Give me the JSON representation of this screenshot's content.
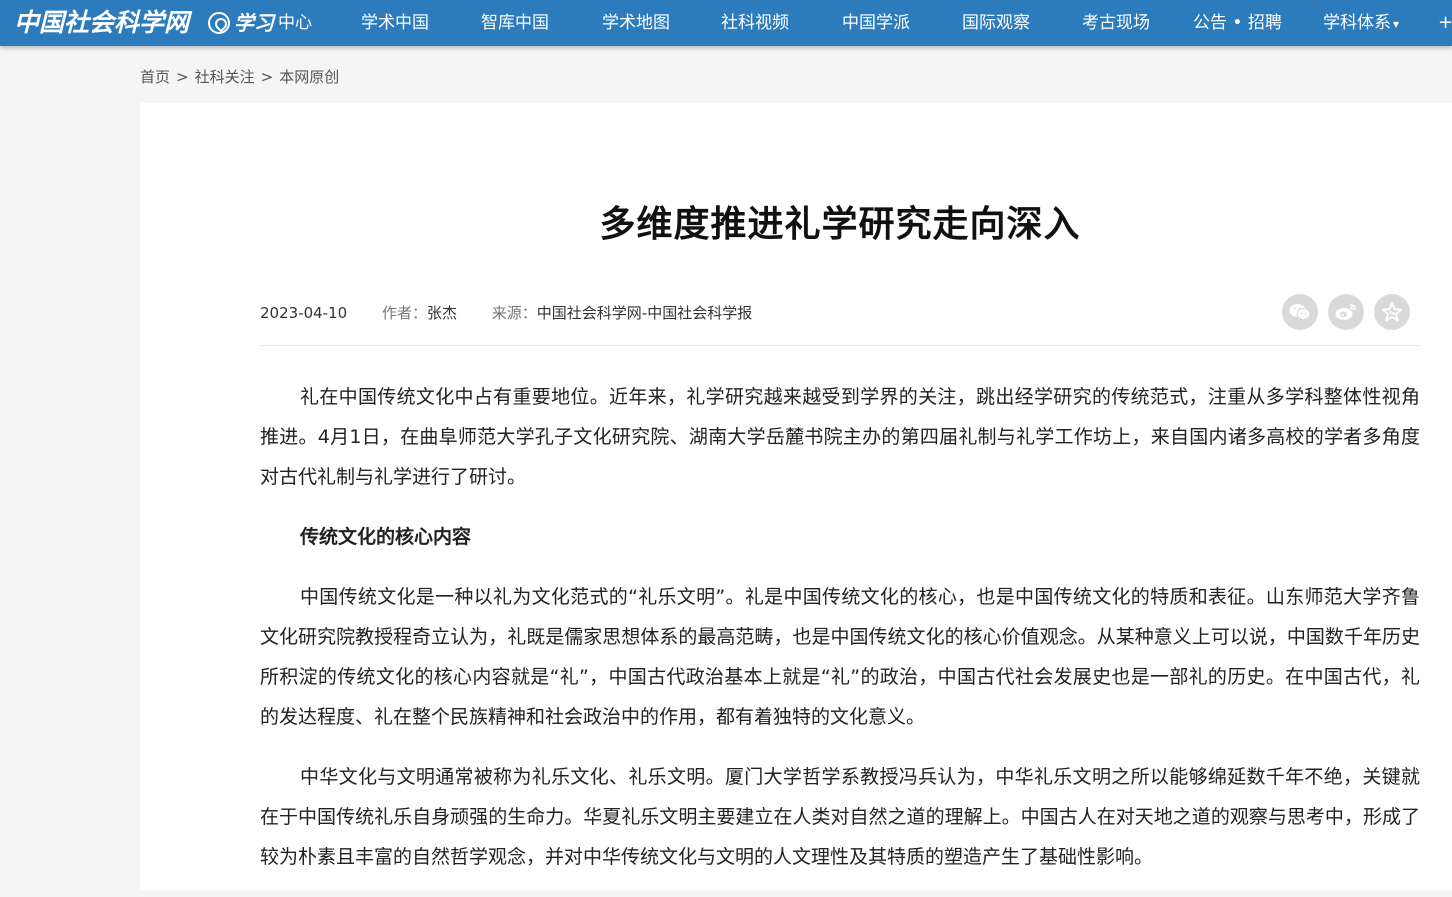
{
  "site": {
    "logo_text": "中国社会科学网"
  },
  "nav": {
    "study_script": "学习",
    "study_label": "中心",
    "items": [
      "学术中国",
      "智库中国",
      "学术地图",
      "社科视频",
      "中国学派",
      "国际观察",
      "考古现场",
      "公告 • 招聘",
      "学科体系"
    ],
    "more_label": "+"
  },
  "breadcrumb": [
    "首页",
    "社科关注",
    "本网原创"
  ],
  "article": {
    "title": "多维度推进礼学研究走向深入",
    "date": "2023-04-10",
    "author_label": "作者：",
    "author": "张杰",
    "source_label": "来源：",
    "source": "中国社会科学网-中国社会科学报",
    "paragraphs": [
      "礼在中国传统文化中占有重要地位。近年来，礼学研究越来越受到学界的关注，跳出经学研究的传统范式，注重从多学科整体性视角推进。4月1日，在曲阜师范大学孔子文化研究院、湖南大学岳麓书院主办的第四届礼制与礼学工作坊上，来自国内诸多高校的学者多角度对古代礼制与礼学进行了研讨。",
      "传统文化的核心内容",
      "中国传统文化是一种以礼为文化范式的“礼乐文明”。礼是中国传统文化的核心，也是中国传统文化的特质和表征。山东师范大学齐鲁文化研究院教授程奇立认为，礼既是儒家思想体系的最高范畴，也是中国传统文化的核心价值观念。从某种意义上可以说，中国数千年历史所积淀的传统文化的核心内容就是“礼”，中国古代政治基本上就是“礼”的政治，中国古代社会发展史也是一部礼的历史。在中国古代，礼的发达程度、礼在整个民族精神和社会政治中的作用，都有着独特的文化意义。",
      "中华文化与文明通常被称为礼乐文化、礼乐文明。厦门大学哲学系教授冯兵认为，中华礼乐文明之所以能够绵延数千年不绝，关键就在于中国传统礼乐自身顽强的生命力。华夏礼乐文明主要建立在人类对自然之道的理解上。中国古人在对天地之道的观察与思考中，形成了较为朴素且丰富的自然哲学观念，并对中华传统文化与文明的人文理性及其特质的塑造产生了基础性影响。"
    ]
  },
  "share": [
    "wechat-icon",
    "weibo-icon",
    "favorite-icon"
  ],
  "colors": {
    "nav_bg": "#2c7bbd",
    "share_bg": "#d9d9d9"
  }
}
